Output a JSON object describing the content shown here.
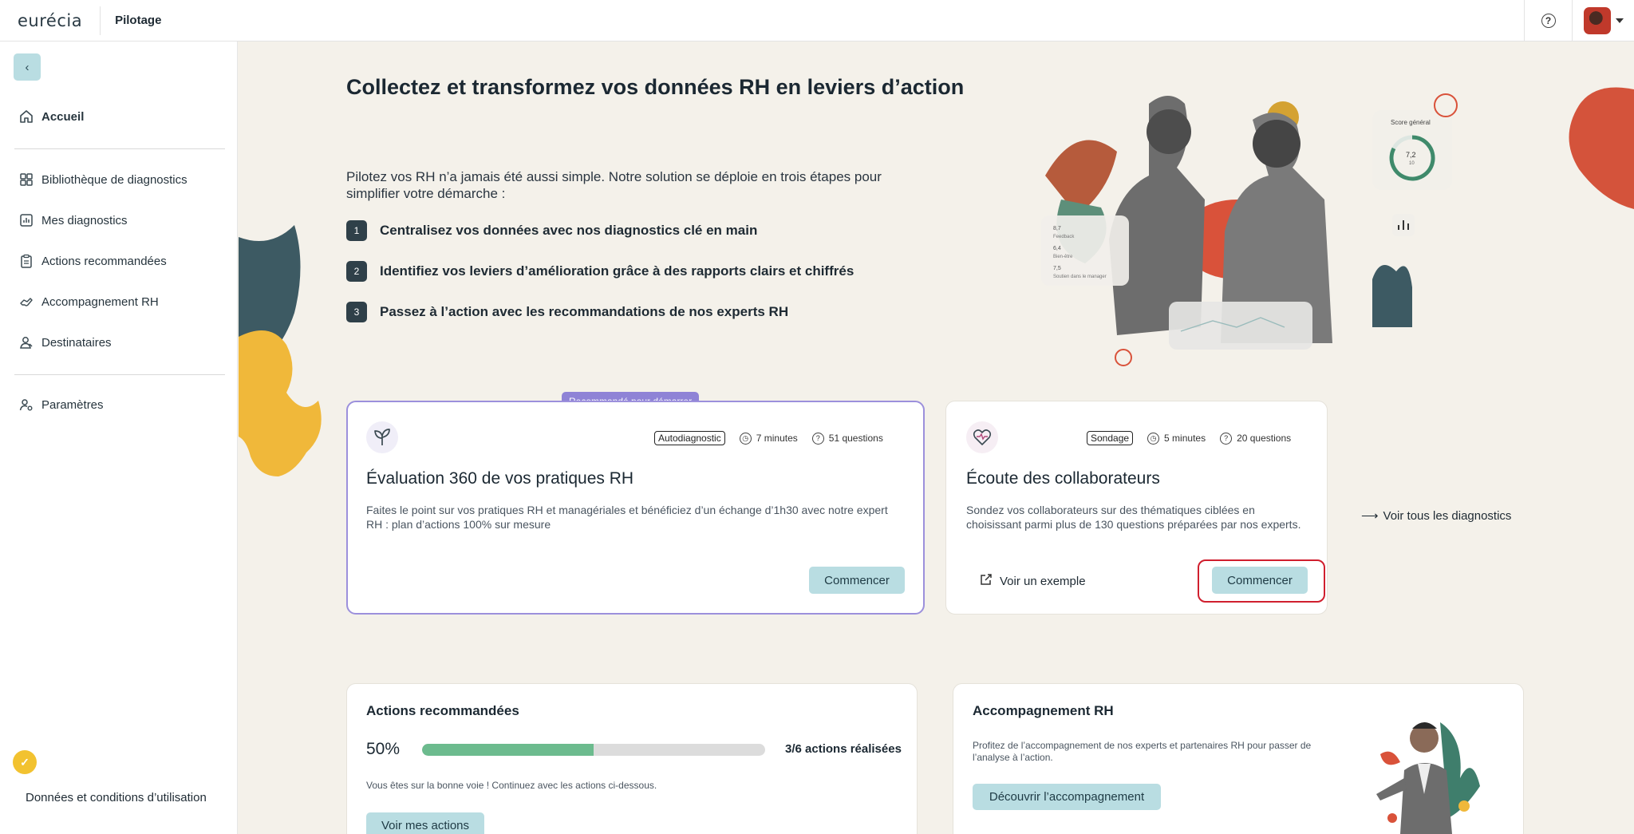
{
  "topbar": {
    "logo": "eurécia",
    "app_name": "Pilotage"
  },
  "sidebar": {
    "items": [
      {
        "label": "Accueil",
        "icon": "home-icon"
      },
      {
        "label": "Bibliothèque de diagnostics",
        "icon": "grid-icon"
      },
      {
        "label": "Mes diagnostics",
        "icon": "bar-chart-icon"
      },
      {
        "label": "Actions recommandées",
        "icon": "clipboard-icon"
      },
      {
        "label": "Accompagnement RH",
        "icon": "handshake-icon"
      },
      {
        "label": "Destinataires",
        "icon": "users-icon"
      },
      {
        "label": "Paramètres",
        "icon": "user-settings-icon"
      }
    ],
    "footer_link": "Données et conditions d’utilisation"
  },
  "hero": {
    "title": "Collectez et transformez vos données RH en leviers d’action",
    "text": "Pilotez vos RH n’a jamais été aussi simple. Notre solution se déploie en trois étapes pour simplifier votre démarche :",
    "steps": [
      {
        "num": "1",
        "text": "Centralisez vos données avec nos diagnostics clé en main"
      },
      {
        "num": "2",
        "text": "Identifiez vos leviers d’amélioration grâce à des rapports clairs et chiffrés"
      },
      {
        "num": "3",
        "text": "Passez à l’action avec les recommandations de nos experts RH"
      }
    ],
    "illustration_labels": {
      "score_label": "Score général",
      "score_value": "7,2",
      "score_scale": "10",
      "rows": [
        "8,7",
        "Feedback",
        "6,4",
        "Bien-être",
        "7,5",
        "Soutien dans le manager"
      ]
    }
  },
  "cards": {
    "recommended_badge": "Recommandé pour démarrer",
    "main": {
      "tag": "Autodiagnostic",
      "duration": "7 minutes",
      "questions": "51 questions",
      "title": "Évaluation 360 de vos pratiques RH",
      "desc": "Faites le point sur vos pratiques RH et managériales et bénéficiez d’un échange d’1h30 avec notre expert RH : plan d’actions 100% sur mesure",
      "button": "Commencer"
    },
    "second": {
      "tag": "Sondage",
      "duration": "5 minutes",
      "questions": "20 questions",
      "title": "Écoute des collaborateurs",
      "desc": "Sondez vos collaborateurs sur des thématiques ciblées en choisissant parmi plus de 130 questions préparées par nos experts.",
      "example_link": "Voir un exemple",
      "button": "Commencer"
    },
    "see_all": "Voir tous les diagnostics"
  },
  "actions": {
    "title": "Actions recommandées",
    "percent": "50%",
    "progress": 0.5,
    "count_label": "3/6 actions réalisées",
    "message": "Vous êtes sur la bonne voie ! Continuez avec les actions ci-dessous.",
    "button": "Voir mes actions"
  },
  "support": {
    "title": "Accompagnement RH",
    "text": "Profitez de l’accompagnement de nos experts et partenaires RH pour passer de l’analyse à l’action.",
    "button": "Découvrir l’accompagnement"
  },
  "colors": {
    "accent_teal": "#b9dde2",
    "accent_purple": "#8f83d6",
    "progress_green": "#6cbb8e",
    "highlight_red": "#d01f2e",
    "background": "#f4f1ea"
  }
}
